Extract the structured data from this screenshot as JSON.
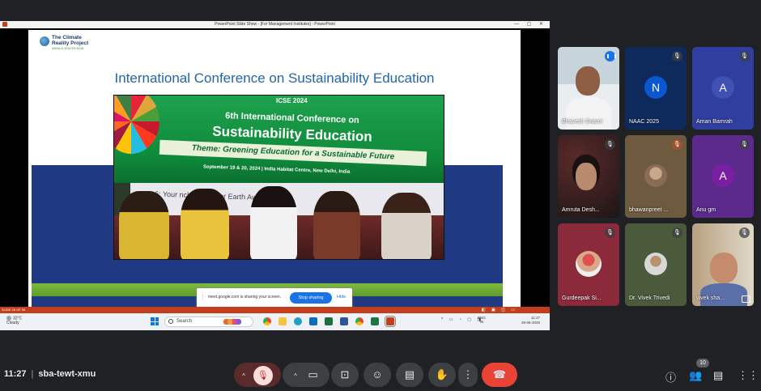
{
  "window_title": "PowerPoint Slide Show - [For Management Institutes] - PowerPoint",
  "slide": {
    "logo_line1": "The Climate",
    "logo_line2": "Reality Project",
    "logo_line3": "INDIA & SOUTH ASIA",
    "title": "International Conference on Sustainability Education",
    "photo": {
      "logo": "ICSE",
      "year": "2024",
      "line1": "6th International Conference on",
      "line2": "Sustainability Education",
      "theme": "Theme: Greening Education for a Sustainable Future",
      "dates": "September 19 & 20, 2024 | India Habitat Centre, New Delhi, India",
      "stage_text": "ry 6: Your  nclave & Yo    or Earth Aw    eremony"
    }
  },
  "share_notice": {
    "text": "meet.google.com is sharing your screen.",
    "stop_label": "Stop sharing",
    "hide_label": "Hide"
  },
  "ppt_status": {
    "slide_info": "SLIDE 28 OF 55"
  },
  "taskbar": {
    "weather_temp": "32°C",
    "weather_desc": "Cloudy",
    "search_label": "Search",
    "lang_line1": "ENG",
    "lang_line2": "IN",
    "time": "11:27",
    "date": "25-06-2025"
  },
  "participants": [
    {
      "name": "Bhavesh Swami",
      "type": "video",
      "speaking": true
    },
    {
      "name": "NAAC 2025",
      "type": "avatar",
      "initial": "N",
      "color": "#0b57d0",
      "bg": "#0e2a5c"
    },
    {
      "name": "Aman Bamrah",
      "type": "avatar",
      "initial": "A",
      "color": "#3949ab",
      "bg": "#303f9f"
    },
    {
      "name": "Amruta Desh...",
      "type": "photo",
      "bg": "#3a2a2a"
    },
    {
      "name": "bhawanpreet ...",
      "type": "photo",
      "bg": "#6e5a3e"
    },
    {
      "name": "Anu gm",
      "type": "avatar",
      "initial": "A",
      "color": "#6a1b9a",
      "bg": "#5b2a8c"
    },
    {
      "name": "Gurdeepak Si...",
      "type": "photo",
      "bg": "#8a2a3a"
    },
    {
      "name": "Dr. Vivek Trivedi",
      "type": "photo",
      "bg": "#4a5a3a"
    },
    {
      "name": "vivek sha...",
      "type": "video",
      "bg": "#8a7560"
    }
  ],
  "meeting": {
    "time": "11:27",
    "code": "sba-tewt-xmu",
    "people_count": "10"
  }
}
